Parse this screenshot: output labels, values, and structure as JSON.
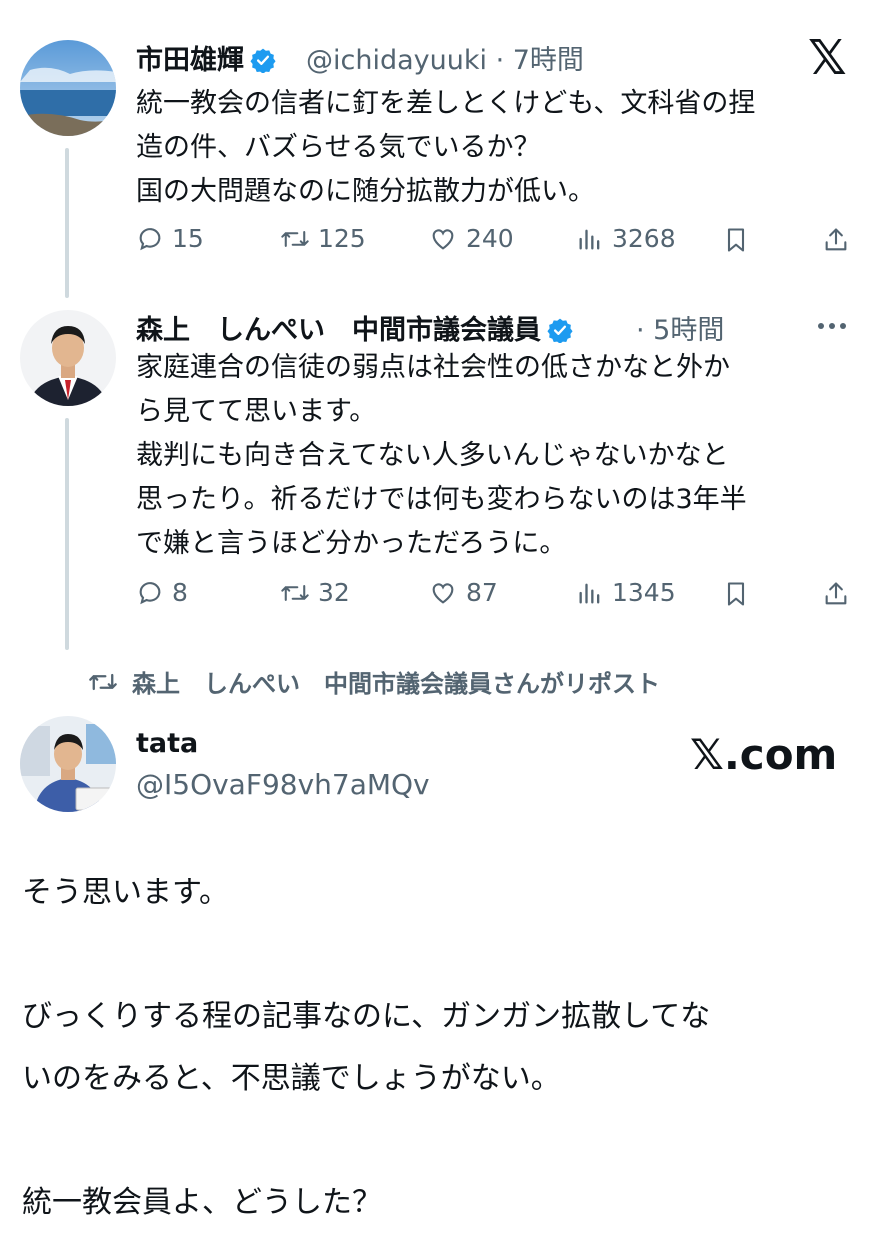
{
  "colors": {
    "verified": "#1d9bf0",
    "muted": "#536471",
    "line": "#cfd9de",
    "text": "#0f1419"
  },
  "tweet1": {
    "display_name": "市田雄輝",
    "handle_time": "@ichidayuuki · 7時間",
    "text": "統一教会の信者に釘を差しとくけども、文科省の捏\n造の件、バズらせる気でいるか？\n国の大問題なのに随分拡散力が低い。",
    "replies": "15",
    "reposts": "125",
    "likes": "240",
    "views": "3268",
    "logo": "𝕏"
  },
  "tweet2": {
    "display_name": "森上　しんぺい　中間市議会議員",
    "time": "· 5時間",
    "text": "家庭連合の信徒の弱点は社会性の低さかなと外か\nら見てて思います。\n裁判にも向き合えてない人多いんじゃないかなと\n思ったり。祈るだけでは何も変わらないのは3年半\nで嫌と言うほど分かっただろうに。",
    "replies": "8",
    "reposts": "32",
    "likes": "87",
    "views": "1345"
  },
  "repost_banner": {
    "text": "森上　しんぺい　中間市議会議員さんがリポスト"
  },
  "tweet3": {
    "display_name": "tata",
    "handle": "@I5OvaF98vh7aMQv",
    "brand": "𝕏.com",
    "text": "そう思います。\n\nびっくりする程の記事なのに、ガンガン拡散してな\nいのをみると、不思議でしょうがない。\n\n統一教会員よ、どうした？"
  },
  "icons": [
    "reply-icon",
    "repost-icon",
    "like-icon",
    "views-icon",
    "bookmark-icon",
    "share-icon",
    "verified-icon",
    "more-icon",
    "x-logo-icon"
  ]
}
